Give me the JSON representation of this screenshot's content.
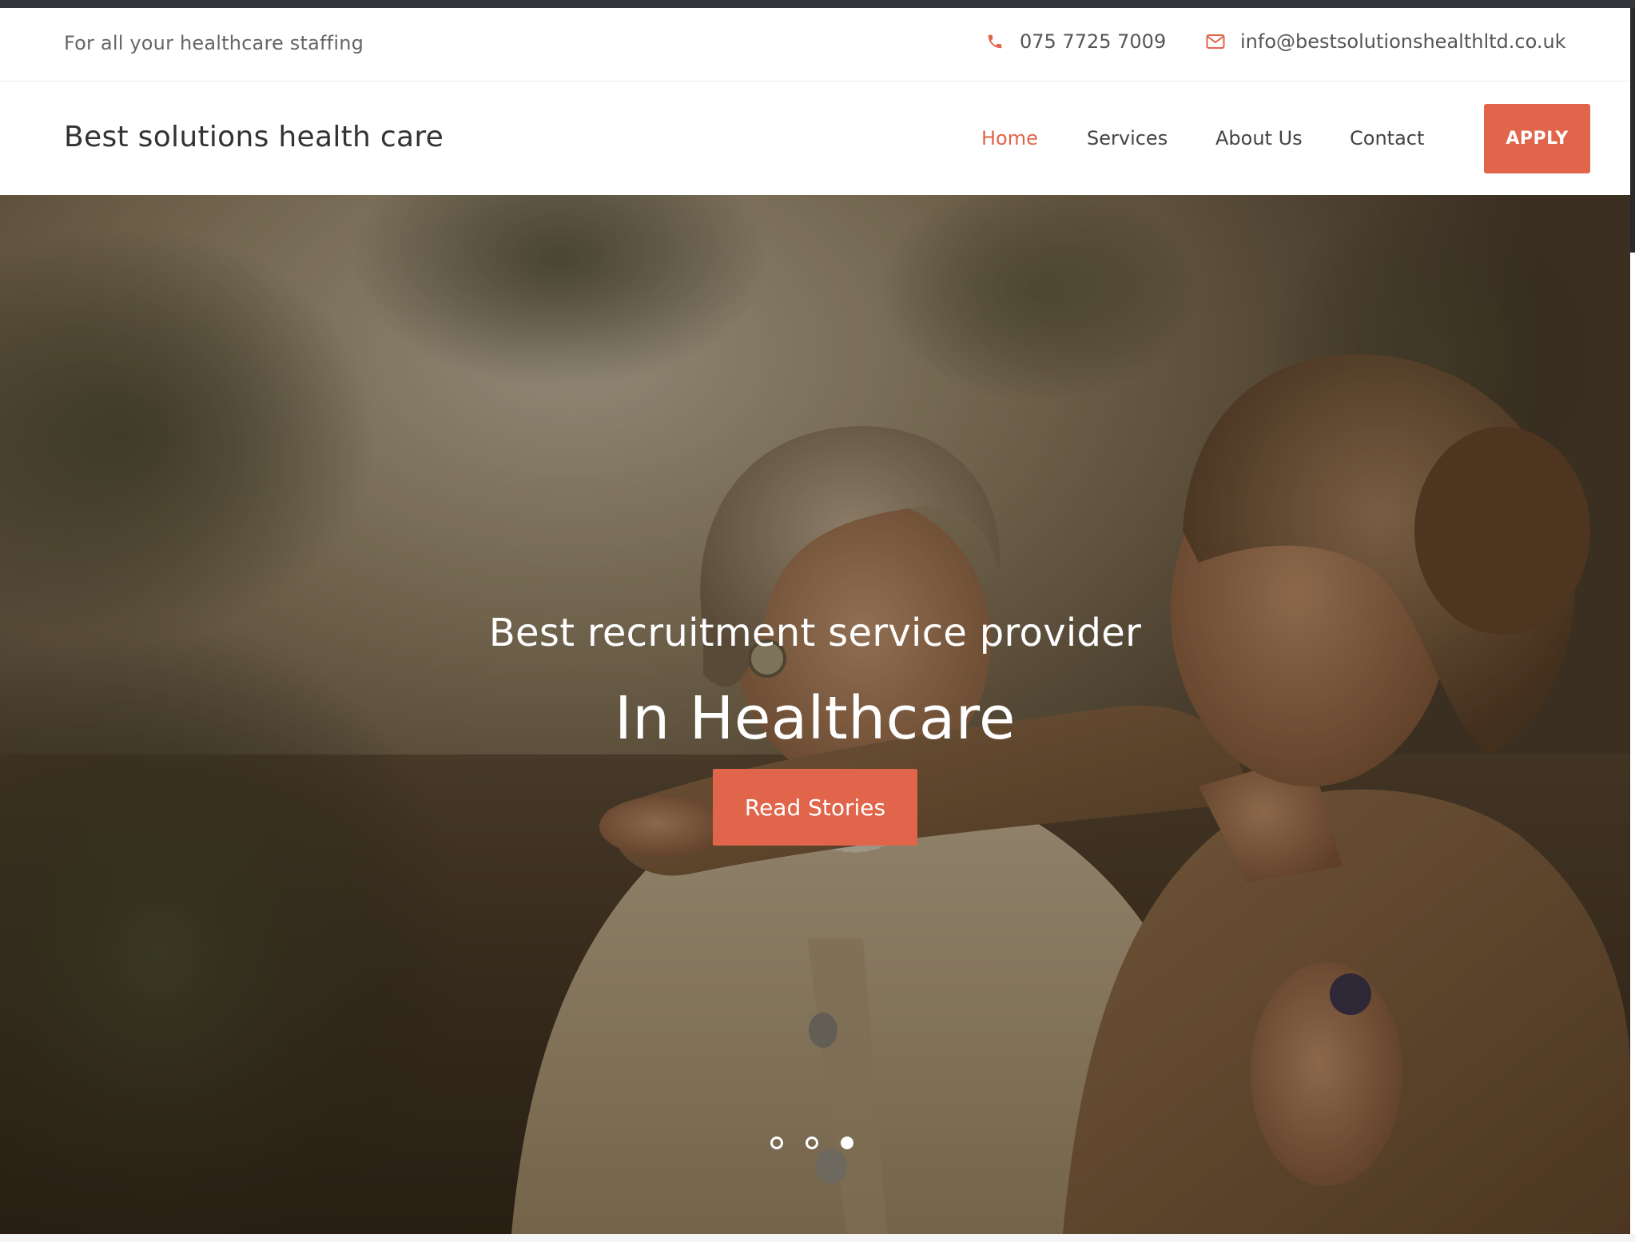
{
  "topbar": {
    "tagline": "For all your healthcare staffing",
    "phone": "075 7725 7009",
    "email": "info@bestsolutionshealthltd.co.uk",
    "phone_icon": "phone-icon",
    "email_icon": "envelope-icon"
  },
  "navbar": {
    "brand": "Best solutions health care",
    "items": [
      {
        "label": "Home",
        "active": true
      },
      {
        "label": "Services",
        "active": false
      },
      {
        "label": "About Us",
        "active": false
      },
      {
        "label": "Contact",
        "active": false
      }
    ],
    "apply_label": "APPLY"
  },
  "hero": {
    "subtitle": "Best recruitment service provider",
    "title": "In Healthcare",
    "button_label": "Read Stories",
    "slides": 3,
    "active_slide": 3
  },
  "colors": {
    "accent": "#e0654a",
    "text_dark": "#333333",
    "text_muted": "#666666",
    "overlay": "rgba(20,14,8,0.28)"
  }
}
